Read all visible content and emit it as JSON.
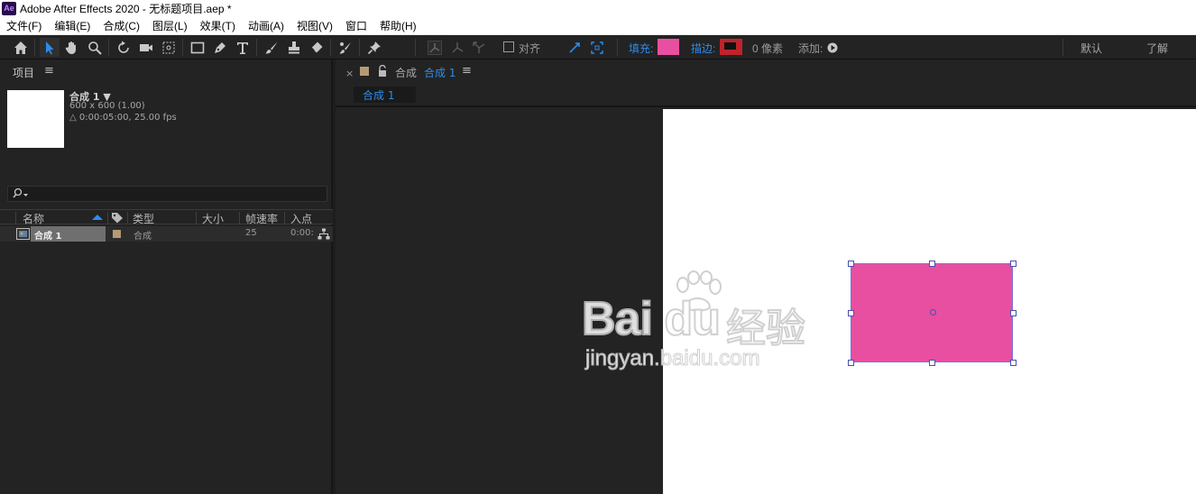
{
  "window": {
    "logo": "Ae",
    "title": "Adobe After Effects 2020 - 无标题项目.aep *"
  },
  "menu": [
    "文件(F)",
    "编辑(E)",
    "合成(C)",
    "图层(L)",
    "效果(T)",
    "动画(A)",
    "视图(V)",
    "窗口",
    "帮助(H)"
  ],
  "toolbar": {
    "align_label": "对齐",
    "fill_label": "填充:",
    "stroke_label": "描边:",
    "stroke_width": "0 像素",
    "add_label": "添加:",
    "workspace_default": "默认",
    "workspace_learn": "了解",
    "fill_color": "#e84fa1",
    "stroke_color": "#c0232a"
  },
  "project_panel": {
    "title": "项目",
    "menu_glyph": "≡",
    "selected_comp": {
      "name": "合成 1 ▼",
      "size": "600 x 600 (1.00)",
      "duration": "△ 0:00:05:00, 25.00 fps"
    },
    "search_placeholder": "",
    "columns": [
      "名称",
      "类型",
      "大小",
      "帧速率",
      "入点"
    ],
    "rows": [
      {
        "name": "合成 1",
        "type": "合成",
        "size": "",
        "fps": "25",
        "in_point": "0:00:",
        "label_color": "#b59a74"
      }
    ]
  },
  "composition_panel": {
    "close_glyph": "×",
    "tab_prefix": "合成",
    "tab_name": "合成 1",
    "menu_glyph": "≡",
    "subtab": "合成 1",
    "shape_color": "#e84fa1"
  },
  "watermark": {
    "brand": "Bai du",
    "brand_cn": "经验",
    "url": "jingyan.baidu.com"
  }
}
